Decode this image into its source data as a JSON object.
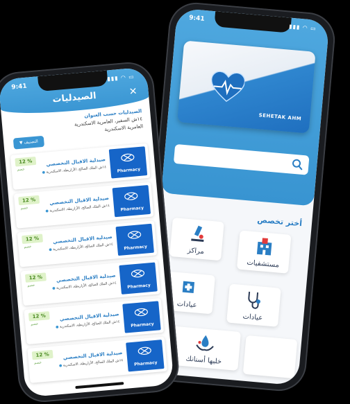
{
  "back_phone": {
    "time": "9:41",
    "card_name": "SEHETAK AHM",
    "section_title": "أختر تخصص",
    "tiles": [
      {
        "label": "مستشفيات",
        "icon": "hospital-icon"
      },
      {
        "label": "مراكز",
        "icon": "microscope-icon"
      },
      {
        "label": "عيادات",
        "icon": "stethoscope-icon"
      },
      {
        "label": "عيادات",
        "icon": "clinic-icon"
      },
      {
        "label": "خليها أسنانك",
        "icon": "care-hands-icon"
      },
      {
        "label": "",
        "icon": "blank-icon"
      }
    ]
  },
  "front_phone": {
    "time": "9:41",
    "title": "الصيدليات",
    "close": "✕",
    "address_label": "الصيدليات حسب العنوان",
    "address_line": "١٤ش السفير، العامرية الاسكندرية",
    "address_city": "العامرية الاسكندرية",
    "filter_label": "التصنيف",
    "pharmacies": [
      {
        "name": "صيدلية الاقبال التخصصي",
        "address": "١٤ش الملك الصالح، الأزاريطة، الاسكندرية",
        "discount": "12 %",
        "tag": "خصم",
        "logo": "Pharmacy"
      },
      {
        "name": "صيدلية الاقبال التخصصي",
        "address": "١٤ش الملك الصالح، الأزاريطة، الاسكندرية",
        "discount": "12 %",
        "tag": "خصم",
        "logo": "Pharmacy"
      },
      {
        "name": "صيدلية الاقبال التخصصي",
        "address": "١٤ش الملك الصالح، الأزاريطة، الاسكندرية",
        "discount": "12 %",
        "tag": "خصم",
        "logo": "Pharmacy"
      },
      {
        "name": "صيدلية الاقبال التخصصي",
        "address": "١٤ش الملك الصالح، الأزاريطة، الاسكندرية",
        "discount": "12 %",
        "tag": "خصم",
        "logo": "Pharmacy"
      },
      {
        "name": "صيدلية الاقبال التخصصي",
        "address": "١٤ش الملك الصالح، الأزاريطة، الاسكندرية",
        "discount": "12 %",
        "tag": "خصم",
        "logo": "Pharmacy"
      },
      {
        "name": "صيدلية الاقبال التخصصي",
        "address": "١٤ش الملك الصالح، الأزاريطة، الاسكندرية",
        "discount": "12 %",
        "tag": "خصم",
        "logo": "Pharmacy"
      }
    ]
  },
  "colors": {
    "primary": "#3a96d3",
    "accent_green": "#4a8a21",
    "logo_blue": "#1665c8"
  }
}
